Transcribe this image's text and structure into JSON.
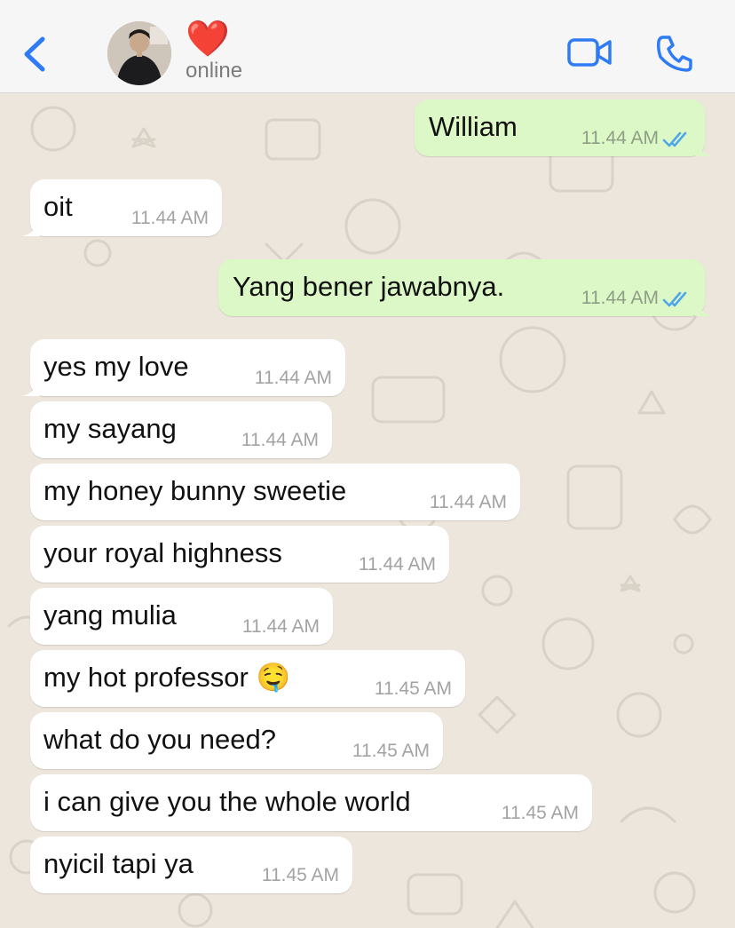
{
  "header": {
    "contact_name": "❤️",
    "status": "online"
  },
  "icons": {
    "back": "chevron-left-icon",
    "video": "video-camera-icon",
    "call": "phone-icon"
  },
  "colors": {
    "accent": "#2f7bf6",
    "bubble_in": "#ffffff",
    "bubble_out": "#dcf8c6",
    "read_ticks": "#4fa6e8",
    "wallpaper": "#ece6dd"
  },
  "messages": [
    {
      "dir": "out",
      "text": "William",
      "time": "11.44 AM",
      "read": true
    },
    {
      "dir": "in",
      "text": "oit",
      "time": "11.44 AM"
    },
    {
      "dir": "out",
      "text": "Yang bener jawabnya.",
      "time": "11.44 AM",
      "read": true
    },
    {
      "dir": "in",
      "text": "yes my love",
      "time": "11.44 AM"
    },
    {
      "dir": "in",
      "text": "my sayang",
      "time": "11.44 AM"
    },
    {
      "dir": "in",
      "text": "my honey bunny sweetie",
      "time": "11.44 AM"
    },
    {
      "dir": "in",
      "text": "your royal highness",
      "time": "11.44 AM"
    },
    {
      "dir": "in",
      "text": "yang mulia",
      "time": "11.44 AM"
    },
    {
      "dir": "in",
      "text": "my hot professor 🤤",
      "time": "11.45 AM"
    },
    {
      "dir": "in",
      "text": "what do you need?",
      "time": "11.45 AM"
    },
    {
      "dir": "in",
      "text": "i can give you the whole world",
      "time": "11.45 AM"
    },
    {
      "dir": "in",
      "text": "nyicil tapi ya",
      "time": "11.45 AM"
    }
  ]
}
